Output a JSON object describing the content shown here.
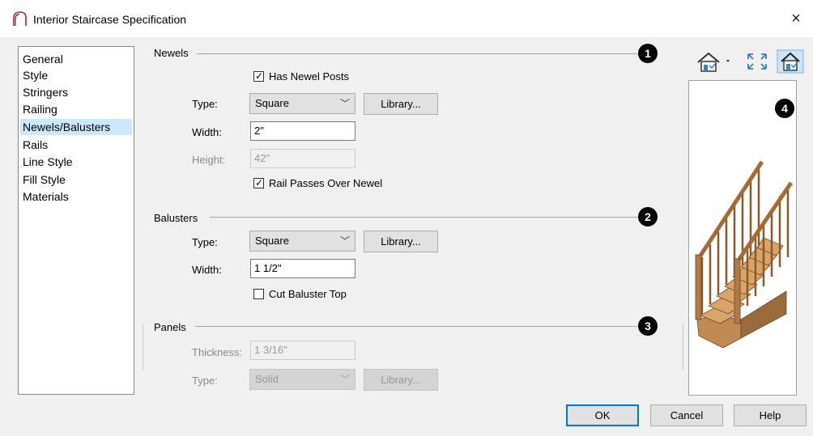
{
  "window": {
    "title": "Interior Staircase Specification",
    "close": "×"
  },
  "nav": {
    "items": [
      "General",
      "Style",
      "Stringers",
      "Railing",
      "Newels/Balusters",
      "Rails",
      "Line Style",
      "Fill Style",
      "Materials"
    ],
    "selected": "Newels/Balusters"
  },
  "newels": {
    "heading": "Newels",
    "badge": "1",
    "has_newel_posts": {
      "label": "Has Newel Posts",
      "checked": true
    },
    "type_label": "Type:",
    "type_value": "Square",
    "library": "Library...",
    "width_label": "Width:",
    "width_value": "2\"",
    "height_label": "Height:",
    "height_value": "42\"",
    "rail_passes": {
      "label": "Rail Passes Over Newel",
      "checked": true
    }
  },
  "balusters": {
    "heading": "Balusters",
    "badge": "2",
    "type_label": "Type:",
    "type_value": "Square",
    "library": "Library...",
    "width_label": "Width:",
    "width_value": "1 1/2\"",
    "cut_top": {
      "label": "Cut Baluster Top",
      "checked": false
    }
  },
  "panels": {
    "heading": "Panels",
    "badge": "3",
    "thickness_label": "Thickness:",
    "thickness_value": "1 3/16\"",
    "type_label": "Type:",
    "type_value": "Solid",
    "library": "Library..."
  },
  "preview": {
    "badge": "4",
    "icons": [
      "camera-view-icon",
      "fill-window-icon",
      "material-view-icon"
    ]
  },
  "buttons": {
    "ok": "OK",
    "cancel": "Cancel",
    "help": "Help"
  },
  "colors": {
    "accent": "#0078d7",
    "selection": "#cce8ff",
    "wood": "#b07a45"
  }
}
